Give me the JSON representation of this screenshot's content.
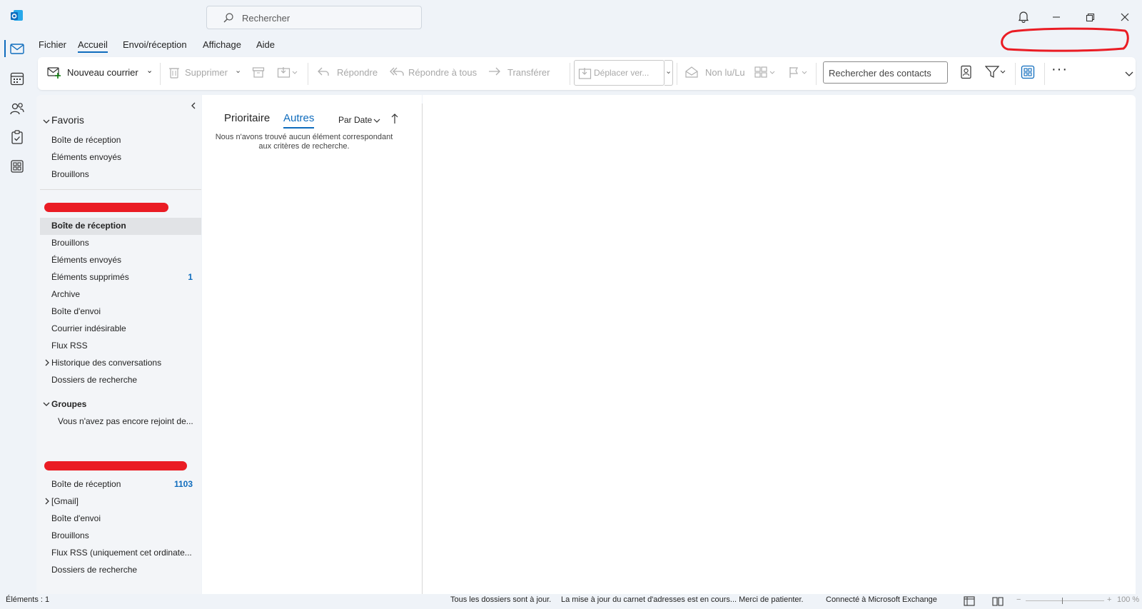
{
  "titlebar": {
    "search_placeholder": "Rechercher"
  },
  "menu": {
    "items": [
      "Fichier",
      "Accueil",
      "Envoi/réception",
      "Affichage",
      "Aide"
    ],
    "active": "Accueil"
  },
  "ribbon": {
    "new_mail": "Nouveau courrier",
    "delete": "Supprimer",
    "reply": "Répondre",
    "reply_all": "Répondre à tous",
    "forward": "Transférer",
    "move_to": "Déplacer ver...",
    "unread_read": "Non lu/Lu",
    "contact_search_placeholder": "Rechercher des contacts"
  },
  "folders": {
    "favorites_title": "Favoris",
    "favorites": [
      "Boîte de réception",
      "Éléments envoyés",
      "Brouillons"
    ],
    "account1": [
      {
        "label": "Boîte de réception",
        "count": "",
        "selected": true
      },
      {
        "label": "Brouillons",
        "count": ""
      },
      {
        "label": "Éléments envoyés",
        "count": ""
      },
      {
        "label": "Éléments supprimés",
        "count": "1"
      },
      {
        "label": "Archive",
        "count": ""
      },
      {
        "label": "Boîte d'envoi",
        "count": ""
      },
      {
        "label": "Courrier indésirable",
        "count": ""
      },
      {
        "label": "Flux RSS",
        "count": ""
      },
      {
        "label": "Historique des conversations",
        "count": "",
        "expandable": true
      },
      {
        "label": "Dossiers de recherche",
        "count": ""
      }
    ],
    "groups_title": "Groupes",
    "groups_empty": "Vous n'avez pas encore rejoint de...",
    "account2": [
      {
        "label": "Boîte de réception",
        "count": "1103"
      },
      {
        "label": "[Gmail]",
        "count": "",
        "expandable": true
      },
      {
        "label": "Boîte d'envoi",
        "count": ""
      },
      {
        "label": "Brouillons",
        "count": ""
      },
      {
        "label": "Flux RSS (uniquement cet ordinate...",
        "count": ""
      },
      {
        "label": "Dossiers de recherche",
        "count": ""
      }
    ]
  },
  "message_list": {
    "tab_focused": "Prioritaire",
    "tab_other": "Autres",
    "sort_label": "Par Date",
    "empty_line1": "Nous n'avons trouvé aucun élément correspondant",
    "empty_line2": "aux critères de recherche."
  },
  "statusbar": {
    "items_count": "Éléments : 1",
    "sync_status": "Tous les dossiers sont à jour.",
    "address_book": "La mise à jour du carnet d'adresses est en cours... Merci de patienter.",
    "connection": "Connecté à Microsoft Exchange",
    "zoom": "100 %"
  },
  "colors": {
    "accent": "#0f6cbd",
    "redaction": "#ea1c24",
    "background": "#eff3f8"
  }
}
